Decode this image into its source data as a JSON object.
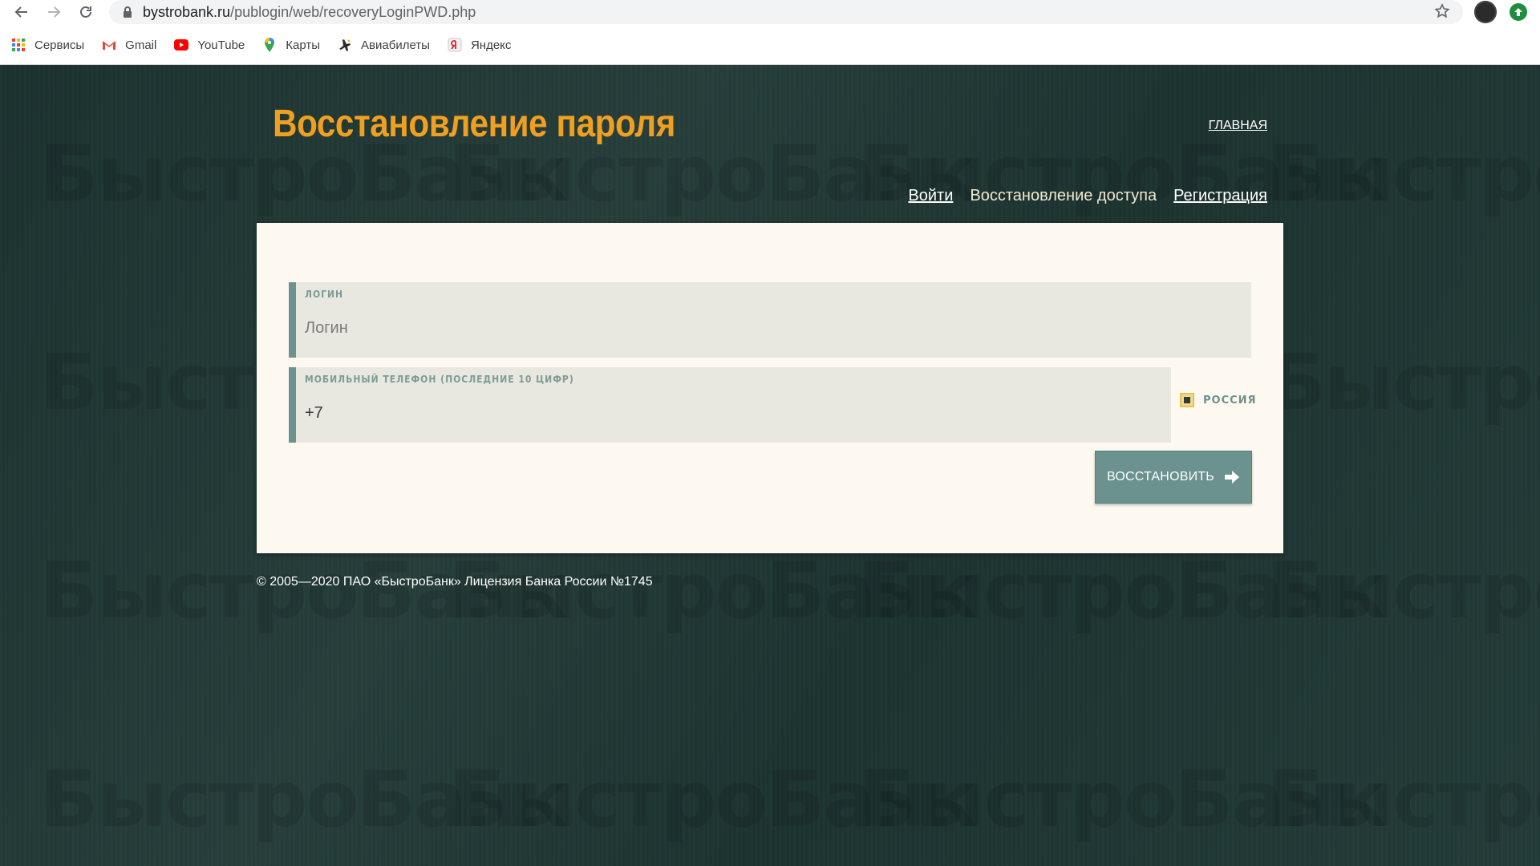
{
  "browser": {
    "url_host": "bystrobank.ru",
    "url_path": "/publogin/web/recoveryLoginPWD.php",
    "bookmarks": [
      {
        "label": "Сервисы",
        "icon": "apps-grid-icon"
      },
      {
        "label": "Gmail",
        "icon": "gmail-icon"
      },
      {
        "label": "YouTube",
        "icon": "youtube-icon"
      },
      {
        "label": "Карты",
        "icon": "maps-pin-icon"
      },
      {
        "label": "Авиабилеты",
        "icon": "plane-icon"
      },
      {
        "label": "Яндекс",
        "icon": "yandex-icon"
      }
    ]
  },
  "page": {
    "title": "Восстановление пароля",
    "home_link": "ГЛАВНАЯ",
    "watermark": "БыстроБанк",
    "tabs": [
      {
        "label": "Войти",
        "state": "link"
      },
      {
        "label": "Восстановление доступа",
        "state": "active"
      },
      {
        "label": "Регистрация",
        "state": "link"
      }
    ],
    "form": {
      "login": {
        "label": "ЛОГИН",
        "placeholder": "Логин",
        "value": ""
      },
      "phone": {
        "label": "МОБИЛЬНЫЙ ТЕЛЕФОН (ПОСЛЕДНИЕ 10 ЦИФР)",
        "value": "+7"
      },
      "country": {
        "label": "РОССИЯ",
        "checked": true
      },
      "submit_label": "ВОССТАНОВИТЬ"
    },
    "footer": "© 2005—2020 ПАО «БыстроБанк» Лицензия Банка России №1745"
  },
  "colors": {
    "background": "#1f3734",
    "title": "#f0a020",
    "card": "#fdf8f0",
    "field": "#e8e7e0",
    "accent": "#6b928e"
  }
}
